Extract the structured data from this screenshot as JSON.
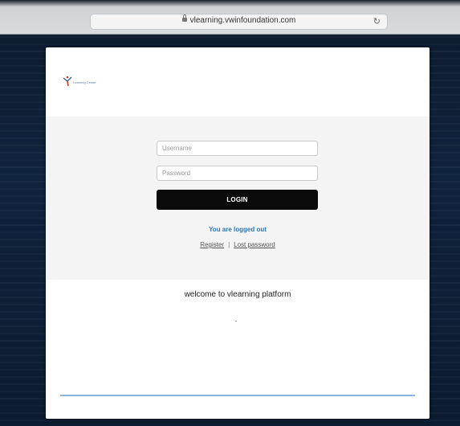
{
  "browser": {
    "url": "vlearning.vwinfoundation.com"
  },
  "logo": {
    "text": "Learning Center"
  },
  "login": {
    "username_placeholder": "Username",
    "password_placeholder": "Password",
    "button_label": "LOGIN",
    "status_message": "You are logged out",
    "register_link": "Register",
    "separator": "|",
    "lost_password_link": "Lost password"
  },
  "main": {
    "welcome_text": "welcome to vlearning platform"
  },
  "colors": {
    "accent_link": "#2b78b9",
    "button_bg": "#0a0a0a",
    "panel_bg": "#f4f4f4",
    "footer_line": "#8ab4dd"
  },
  "icons": [
    "lock-icon",
    "reload-icon",
    "logo-icon"
  ]
}
